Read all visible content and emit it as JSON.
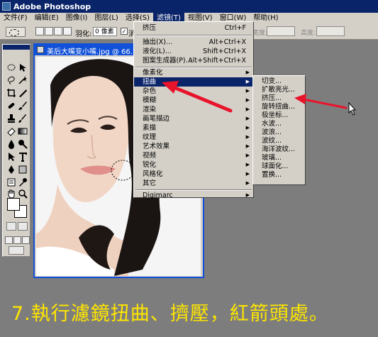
{
  "window": {
    "title": "Adobe Photoshop"
  },
  "menubar": {
    "items": [
      {
        "label": "文件(F)"
      },
      {
        "label": "编辑(E)"
      },
      {
        "label": "图像(I)"
      },
      {
        "label": "图层(L)"
      },
      {
        "label": "选择(S)"
      },
      {
        "label": "滤镜(T)"
      },
      {
        "label": "视图(V)"
      },
      {
        "label": "窗口(W)"
      },
      {
        "label": "帮助(H)"
      }
    ],
    "active_index": 5
  },
  "options_bar": {
    "feather_label": "羽化:",
    "feather_value": "0 像素",
    "antialias_label": "消",
    "antialias_checked": true,
    "width_label": "宽度:",
    "height_label": "高度:"
  },
  "document": {
    "title": "美后大嘴变小嘴.jpg @ 66.7"
  },
  "filter_menu": {
    "top_items": [
      {
        "label": "挤压",
        "shortcut": "Ctrl+F"
      }
    ],
    "group2": [
      {
        "label": "抽出(X)...",
        "shortcut": "Alt+Ctrl+X"
      },
      {
        "label": "液化(L)...",
        "shortcut": "Shift+Ctrl+X"
      },
      {
        "label": "图案生成器(P)...",
        "shortcut": "Alt+Shift+Ctrl+X"
      }
    ],
    "group3": [
      {
        "label": "像素化"
      },
      {
        "label": "扭曲"
      },
      {
        "label": "杂色"
      },
      {
        "label": "模糊"
      },
      {
        "label": "渲染"
      },
      {
        "label": "画笔描边"
      },
      {
        "label": "素描"
      },
      {
        "label": "纹理"
      },
      {
        "label": "艺术效果"
      },
      {
        "label": "视频"
      },
      {
        "label": "锐化"
      },
      {
        "label": "风格化"
      },
      {
        "label": "其它"
      }
    ],
    "group4": [
      {
        "label": "Digimarc"
      }
    ],
    "active_label": "扭曲"
  },
  "distort_submenu": {
    "items": [
      {
        "label": "切变..."
      },
      {
        "label": "扩散亮光..."
      },
      {
        "label": "挤压..."
      },
      {
        "label": "旋转扭曲..."
      },
      {
        "label": "极坐标..."
      },
      {
        "label": "水波..."
      },
      {
        "label": "波浪..."
      },
      {
        "label": "波纹..."
      },
      {
        "label": "海洋波纹..."
      },
      {
        "label": "玻璃..."
      },
      {
        "label": "球面化..."
      },
      {
        "label": "置换..."
      }
    ]
  },
  "caption": {
    "text": "7.執行濾鏡扭曲、擠壓，紅箭頭處。"
  },
  "colors": {
    "annotation_arrow": "#e8142c",
    "caption": "#ffe600",
    "menu_highlight": "#0a246a",
    "doc_titlebar": "#1150d8"
  }
}
